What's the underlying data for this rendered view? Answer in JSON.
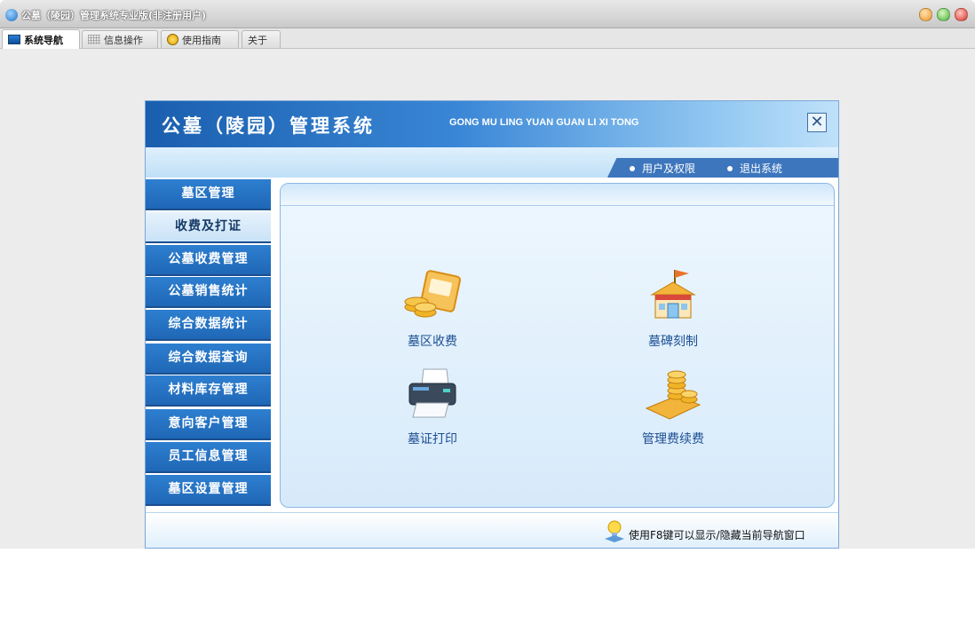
{
  "window": {
    "title": "公墓（陵园）管理系统专业版(非注册用户)"
  },
  "tabs": [
    {
      "label": "系统导航",
      "icon": "nav-icon",
      "active": true
    },
    {
      "label": "信息操作",
      "icon": "grid-icon",
      "active": false
    },
    {
      "label": "使用指南",
      "icon": "guide-icon",
      "active": false
    },
    {
      "label": "关于",
      "icon": "",
      "active": false
    }
  ],
  "panel": {
    "title": "公墓（陵园）管理系统",
    "subtitle": "GONG MU LING YUAN GUAN LI XI TONG",
    "close_glyph": "✕",
    "links": {
      "users": "用户及权限",
      "exit": "退出系统"
    }
  },
  "menu": [
    {
      "label": "墓区管理"
    },
    {
      "label": "收费及打证",
      "selected": true
    },
    {
      "label": "公墓收费管理"
    },
    {
      "label": "公墓销售统计"
    },
    {
      "label": "综合数据统计"
    },
    {
      "label": "综合数据查询"
    },
    {
      "label": "材料库存管理"
    },
    {
      "label": "意向客户管理"
    },
    {
      "label": "员工信息管理"
    },
    {
      "label": "墓区设置管理"
    }
  ],
  "features": [
    {
      "label": "墓区收费",
      "icon": "coins-card-icon"
    },
    {
      "label": "墓碑刻制",
      "icon": "shop-icon"
    },
    {
      "label": "墓证打印",
      "icon": "printer-icon"
    },
    {
      "label": "管理费续费",
      "icon": "coin-stack-icon"
    }
  ],
  "footer": {
    "hint": "使用F8键可以显示/隐藏当前导航窗口"
  },
  "colors": {
    "menu_blue": "#2e7fd0",
    "header_blue": "#1a5fae",
    "label_blue": "#1c4f93"
  }
}
